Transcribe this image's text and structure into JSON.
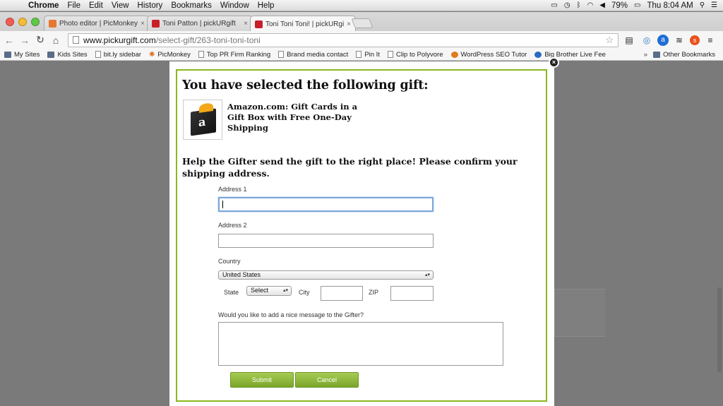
{
  "menubar": {
    "apple_icon": "apple-icon",
    "items": [
      "Chrome",
      "File",
      "Edit",
      "View",
      "History",
      "Bookmarks",
      "Window",
      "Help"
    ],
    "battery": "79%",
    "clock": "Thu 8:04 AM"
  },
  "tabs": [
    {
      "title": "Photo editor | PicMonkey:",
      "favicon_color": "#e8772e"
    },
    {
      "title": "Toni Patton | pickURgift",
      "favicon_color": "#c8202a"
    },
    {
      "title": "Toni Toni Toni! | pickURgift",
      "favicon_color": "#c8202a"
    }
  ],
  "address_bar": {
    "host": "www.pickurgift.com",
    "path": "/select-gift/263-toni-toni-toni"
  },
  "bookmarks": [
    {
      "label": "My Sites",
      "icon": "folder"
    },
    {
      "label": "Kids Sites",
      "icon": "folder"
    },
    {
      "label": "bit.ly sidebar",
      "icon": "doc"
    },
    {
      "label": "PicMonkey",
      "icon": "pm"
    },
    {
      "label": "Top PR Firm Ranking",
      "icon": "doc"
    },
    {
      "label": "Brand media contact",
      "icon": "doc"
    },
    {
      "label": "Pin It",
      "icon": "doc"
    },
    {
      "label": "Clip to Polyvore",
      "icon": "doc"
    },
    {
      "label": "WordPress SEO Tutor",
      "icon": "wp"
    },
    {
      "label": "Big Brother Live Fee",
      "icon": "bb"
    }
  ],
  "bookmarks_overflow": "»",
  "other_bookmarks": "Other Bookmarks",
  "modal": {
    "heading": "You have selected the following gift:",
    "gift_title": "Amazon.com: Gift Cards in a Gift Box with Free One-Day Shipping",
    "gift_logo_letter": "a",
    "help_text": "Help the Gifter send the gift to the right place! Please confirm your shipping address.",
    "address1_label": "Address 1",
    "address1_value": "",
    "address2_label": "Address 2",
    "address2_value": "",
    "country_label": "Country",
    "country_value": "United States",
    "state_label": "State",
    "state_value": "Select",
    "city_label": "City",
    "city_value": "",
    "zip_label": "ZIP",
    "zip_value": "",
    "message_label": "Would you like to add a nice message to the Gifter?",
    "message_value": "",
    "submit_label": "Submit",
    "cancel_label": "Cancel",
    "close_label": "×",
    "accent_color": "#8ab81d"
  }
}
